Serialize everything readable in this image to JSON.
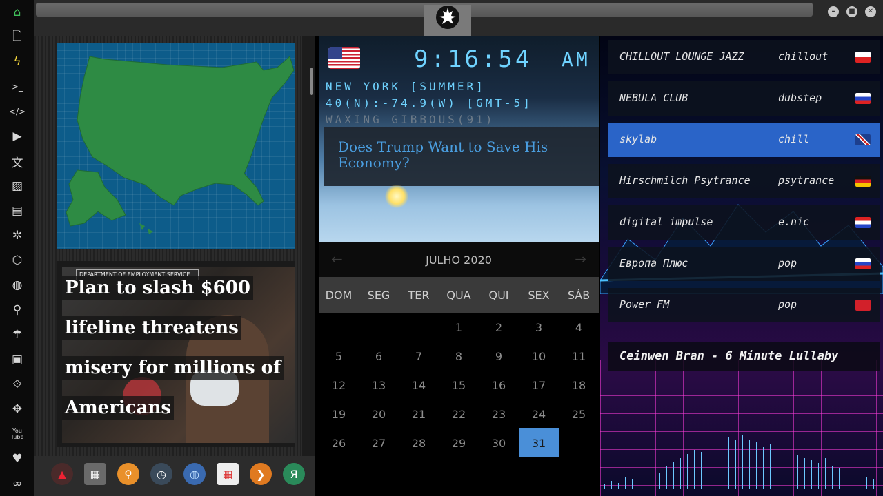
{
  "sidebar": {
    "items": [
      {
        "icon": "home-icon",
        "glyph": "⌂"
      },
      {
        "icon": "document-icon",
        "glyph": "🗋"
      },
      {
        "icon": "lightning-icon",
        "glyph": "ϟ"
      },
      {
        "icon": "terminal-icon",
        "glyph": ">_"
      },
      {
        "icon": "code-icon",
        "glyph": "</>"
      },
      {
        "icon": "play-icon",
        "glyph": "▶"
      },
      {
        "icon": "translate-icon",
        "glyph": "文"
      },
      {
        "icon": "image-icon",
        "glyph": "▨"
      },
      {
        "icon": "news-icon",
        "glyph": "▤"
      },
      {
        "icon": "rebel-alliance-icon",
        "glyph": "✲"
      },
      {
        "icon": "hexagon-icon",
        "glyph": "⬡"
      },
      {
        "icon": "globe-icon",
        "glyph": "◍"
      },
      {
        "icon": "search-icon",
        "glyph": "⚲"
      },
      {
        "icon": "umbrella-icon",
        "glyph": "☂"
      },
      {
        "icon": "contact-card-icon",
        "glyph": "▣"
      },
      {
        "icon": "link-icon",
        "glyph": "⟐"
      },
      {
        "icon": "expand-icon",
        "glyph": "✥"
      },
      {
        "icon": "youtube-icon",
        "glyph": "You\nTube"
      },
      {
        "icon": "heart-icon",
        "glyph": "♥"
      },
      {
        "icon": "infinity-icon",
        "glyph": "∞"
      }
    ]
  },
  "window": {
    "emblem_icon": "rebel-alliance-icon",
    "controls": [
      "minimize",
      "maximize",
      "close"
    ]
  },
  "news": {
    "headline_lines": [
      "Plan to slash $600",
      "lifeline threatens",
      "misery for millions of",
      "Americans"
    ],
    "image_sign_text": "DEPARTMENT OF EMPLOYMENT SERVICE"
  },
  "dock": {
    "items": [
      "red-mountain-icon",
      "calendar-list-icon",
      "magnifier-icon",
      "clock-icon",
      "globe-icon",
      "calendar-clock-icon",
      "arrow-right-icon",
      "yandex-icon"
    ]
  },
  "clock": {
    "time": "9:16:54",
    "ampm": "AM",
    "location": "NEW YORK [SUMMER]",
    "coords": "40(N):-74.9(W) [GMT-5]",
    "moon": "WAXING GIBBOUS(91)"
  },
  "headline_card": {
    "text": "Does Trump Want to Save His Economy?"
  },
  "calendar": {
    "month": "JULHO 2020",
    "weekdays": [
      "DOM",
      "SEG",
      "TER",
      "QUA",
      "QUI",
      "SEX",
      "SÁB"
    ],
    "leading_blanks": 3,
    "days": [
      "1",
      "2",
      "3",
      "4",
      "5",
      "6",
      "7",
      "8",
      "9",
      "10",
      "11",
      "12",
      "13",
      "14",
      "15",
      "16",
      "17",
      "18",
      "19",
      "20",
      "21",
      "22",
      "23",
      "24",
      "25",
      "26",
      "27",
      "28",
      "29",
      "30",
      "31"
    ],
    "selected": "31"
  },
  "radio": {
    "stations": [
      {
        "name": "CHILLOUT LOUNGE JAZZ",
        "genre": "chillout",
        "flag": "poland"
      },
      {
        "name": "NEBULA CLUB",
        "genre": "dubstep",
        "flag": "russia"
      },
      {
        "name": "skylab",
        "genre": "chill",
        "flag": "uk",
        "active": true
      },
      {
        "name": "Hirschmilch Psytrance",
        "genre": "psytrance",
        "flag": "germany"
      },
      {
        "name": "digital impulse",
        "genre": "e.nic",
        "flag": "croatia"
      },
      {
        "name": "Европа Плюс",
        "genre": "pop",
        "flag": "russia"
      },
      {
        "name": "Power FM",
        "genre": "pop",
        "flag": "turkey"
      }
    ],
    "now_playing": "Ceinwen Bran - 6 Minute Lullaby",
    "spectrum": [
      0.05,
      0.08,
      0.06,
      0.12,
      0.1,
      0.15,
      0.18,
      0.2,
      0.16,
      0.22,
      0.26,
      0.3,
      0.34,
      0.38,
      0.36,
      0.4,
      0.45,
      0.42,
      0.5,
      0.47,
      0.52,
      0.48,
      0.46,
      0.41,
      0.44,
      0.37,
      0.4,
      0.35,
      0.33,
      0.3,
      0.28,
      0.25,
      0.3,
      0.22,
      0.2,
      0.18,
      0.24,
      0.15,
      0.12,
      0.1
    ]
  }
}
